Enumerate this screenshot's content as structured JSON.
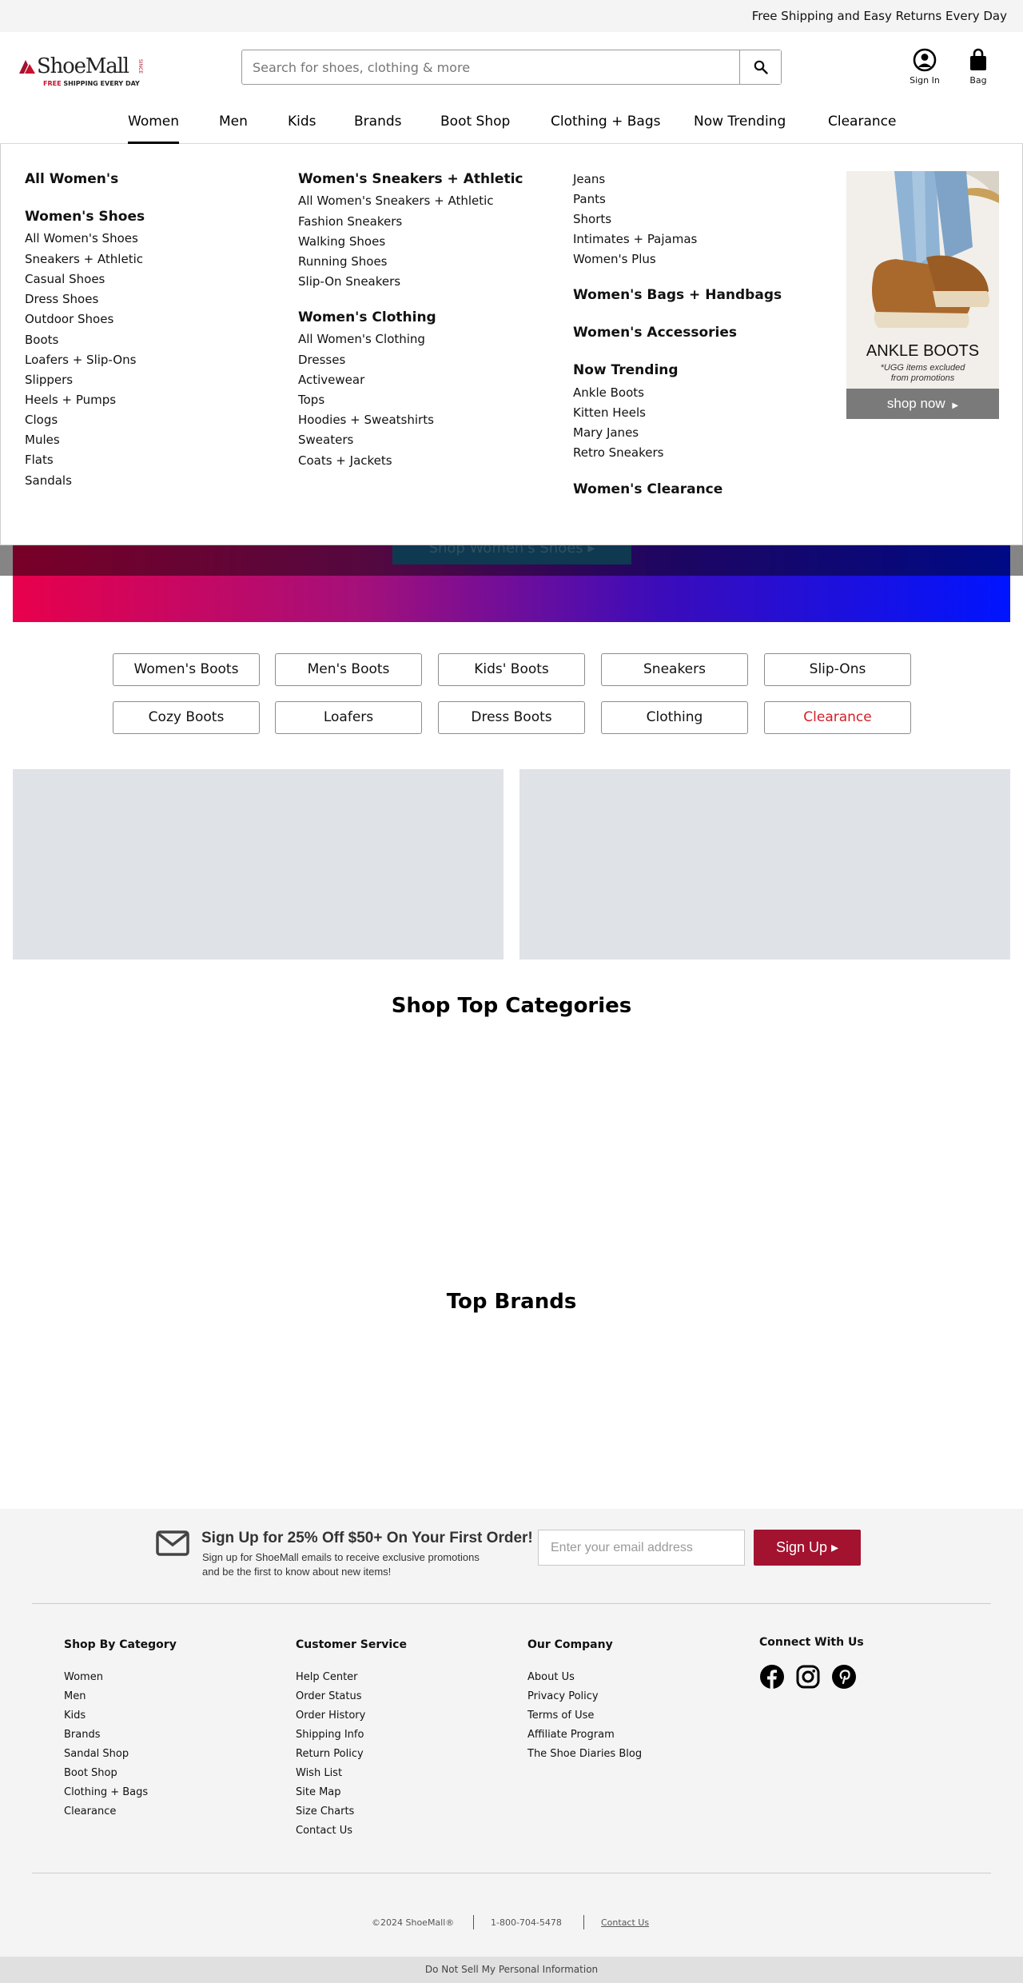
{
  "promo": {
    "text": "Free Shipping and Easy Returns Every Day"
  },
  "logo": {
    "name": "ShoeMall",
    "tagline_red": "FREE",
    "tagline_rest": " SHIPPING EVERY DAY",
    "since": "SINCE"
  },
  "search": {
    "placeholder": "Search for shoes, clothing & more",
    "value": ""
  },
  "header_actions": {
    "sign_in": "Sign In",
    "bag": "Bag"
  },
  "nav": {
    "active": "Women",
    "items": [
      "Women",
      "Men",
      "Kids",
      "Brands",
      "Boot Shop",
      "Clothing + Bags",
      "Now Trending",
      "Clearance"
    ]
  },
  "mega": {
    "col1": {
      "all": "All Women's",
      "shoes_head": "Women's Shoes",
      "shoes": [
        "All Women's Shoes",
        "Sneakers + Athletic",
        "Casual Shoes",
        "Dress Shoes",
        "Outdoor Shoes",
        "Boots",
        "Loafers + Slip-Ons",
        "Slippers",
        "Heels + Pumps",
        "Clogs",
        "Mules",
        "Flats",
        "Sandals"
      ]
    },
    "col2": {
      "sneakers_head": "Women's Sneakers + Athletic",
      "sneakers": [
        "All Women's Sneakers + Athletic",
        "Fashion Sneakers",
        "Walking Shoes",
        "Running Shoes",
        "Slip-On Sneakers"
      ],
      "clothing_head": "Women's Clothing",
      "clothing": [
        "All Women's Clothing",
        "Dresses",
        "Activewear",
        "Tops",
        "Hoodies + Sweatshirts",
        "Sweaters",
        "Coats + Jackets"
      ]
    },
    "col3": {
      "clothing_more": [
        "Jeans",
        "Pants",
        "Shorts",
        "Intimates + Pajamas",
        "Women's Plus"
      ],
      "bags_head": "Women's Bags + Handbags",
      "accessories_head": "Women's Accessories",
      "trending_head": "Now Trending",
      "trending": [
        "Ankle Boots",
        "Kitten Heels",
        "Mary Janes",
        "Retro Sneakers"
      ],
      "clearance_head": "Women's Clearance"
    },
    "promo": {
      "title": "ANKLE BOOTS",
      "note_line1": "*UGG items excluded",
      "note_line2": "from promotions",
      "cta": "shop now"
    }
  },
  "hero": {
    "cta": "Shop Women's Shoes ▸"
  },
  "category_buttons": {
    "row1": [
      "Women's Boots",
      "Men's Boots",
      "Kids' Boots",
      "Sneakers",
      "Slip-Ons"
    ],
    "row2": [
      "Cozy Boots",
      "Loafers",
      "Dress Boots",
      "Clothing",
      "Clearance"
    ]
  },
  "sections": {
    "top_categories": "Shop Top Categories",
    "top_brands": "Top Brands"
  },
  "newsletter": {
    "heading": "Sign Up for 25% Off $50+ On Your First Order!",
    "sub_line1": "Sign up for ShoeMall emails to receive exclusive promotions",
    "sub_line2": "and be the first to know about new items!",
    "placeholder": "Enter your email address",
    "button": "Sign Up ▸"
  },
  "footer": {
    "shop_title": "Shop By Category",
    "shop_links": [
      "Women",
      "Men",
      "Kids",
      "Brands",
      "Sandal Shop",
      "Boot Shop",
      "Clothing + Bags",
      "Clearance"
    ],
    "service_title": "Customer Service",
    "service_links": [
      "Help Center",
      "Order Status",
      "Order History",
      "Shipping Info",
      "Return Policy",
      "Wish List",
      "Site Map",
      "Size Charts",
      "Contact Us"
    ],
    "company_title": "Our Company",
    "company_links": [
      "About Us",
      "Privacy Policy",
      "Terms of Use",
      "Affiliate Program",
      "The Shoe Diaries Blog"
    ],
    "connect_title": "Connect With Us",
    "social": [
      "facebook-icon",
      "instagram-icon",
      "pinterest-icon"
    ],
    "copyright": "©2024 ShoeMall®",
    "phone": "1-800-704-5478",
    "contact": "Contact Us"
  },
  "dnsmpi": "Do Not Sell My Personal Information",
  "colors": {
    "brand_red": "#a3122f",
    "clearance_red": "#d21f26",
    "banner_grey": "#dfe2e6"
  }
}
